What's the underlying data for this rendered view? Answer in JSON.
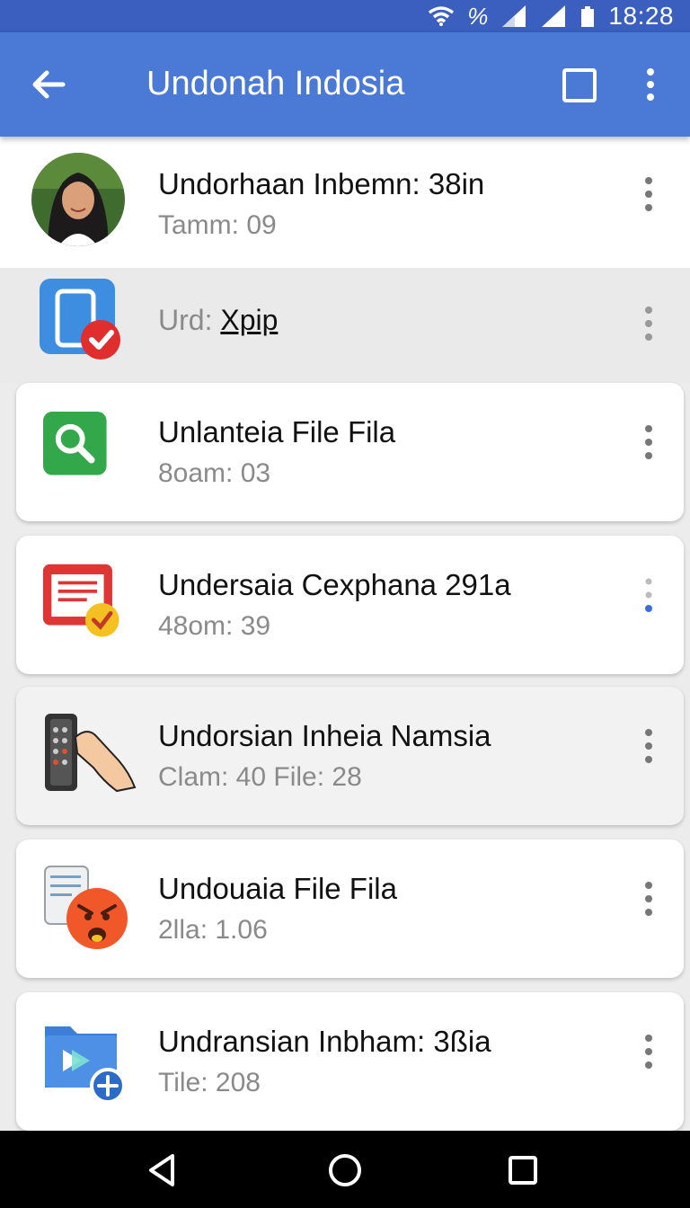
{
  "status_bar": {
    "percent": "%",
    "time": "18:28"
  },
  "app_bar": {
    "title": "Undonah Indosia"
  },
  "items": [
    {
      "title": "Undorhaan Inbemn: 38in",
      "subtitle": "Tamm: 09",
      "icon": "avatar"
    },
    {
      "title": "Urd: ",
      "link": "Xpip",
      "icon": "phone-check-icon"
    },
    {
      "title": "Unlanteia File Fila",
      "subtitle": "8oam: 03",
      "icon": "search-icon"
    },
    {
      "title": "Undersaia Cexphana 291a",
      "subtitle": "48om: 39",
      "icon": "document-check-icon"
    },
    {
      "title": "Undorsian Inheia Namsia",
      "subtitle": "Clam: 40 File: 28",
      "icon": "remote-hand-icon"
    },
    {
      "title": "Undouaia File Fila",
      "subtitle": "2lla: 1.06",
      "icon": "angry-emoji-icon"
    },
    {
      "title": "Undransian Inbham: 3ßia",
      "subtitle": "Tile: 208",
      "icon": "folder-add-icon"
    }
  ],
  "colors": {
    "app_bar": "#4a79d6",
    "status_bar": "#3a5fbf",
    "accent_dot": "#3b6fd8"
  }
}
